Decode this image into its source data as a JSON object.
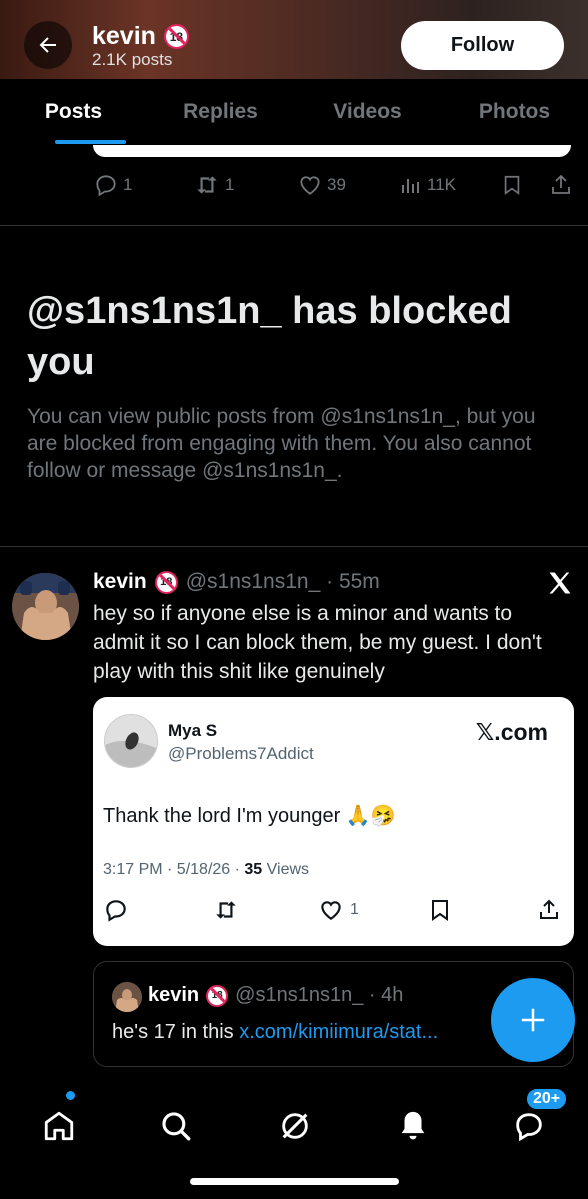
{
  "header": {
    "name": "kevin",
    "badge": "18",
    "post_count": "2.1K posts",
    "follow_label": "Follow"
  },
  "tabs": [
    {
      "label": "Posts",
      "active": true
    },
    {
      "label": "Replies",
      "active": false
    },
    {
      "label": "Videos",
      "active": false
    },
    {
      "label": "Photos",
      "active": false
    }
  ],
  "prev_post_actions": {
    "replies": "1",
    "reposts": "1",
    "likes": "39",
    "views": "11K"
  },
  "blocked": {
    "title": "@s1ns1ns1n_ has blocked you",
    "body": "You can view public posts from @s1ns1ns1n_, but you are blocked from engaging with them. You also cannot follow or message @s1ns1ns1n_."
  },
  "post": {
    "name": "kevin",
    "badge": "18",
    "handle_time": "@s1ns1ns1n_ · 55m",
    "text": "hey so if anyone else is a minor and wants to admit it so I can block them, be my guest. I don't play with this shit like genuinely"
  },
  "embed": {
    "name": "Mya S",
    "handle": "@Problems7Addict",
    "source": "𝕏.com",
    "text": "Thank the lord I'm younger 🙏🤧",
    "meta_time": "3:17 PM · 5/18/26 · ",
    "meta_views_count": "35",
    "meta_views_label": " Views",
    "likes": "1"
  },
  "quote": {
    "name": "kevin",
    "badge": "18",
    "handle_time": "@s1ns1ns1n_ · 4h",
    "text": "he's 17 in this ",
    "link": "x.com/kimiimura/stat..."
  },
  "nav": {
    "messages_badge": "20+"
  },
  "colors": {
    "accent": "#1d9bf0",
    "muted": "#71767b",
    "badge_red": "#e0245e"
  }
}
